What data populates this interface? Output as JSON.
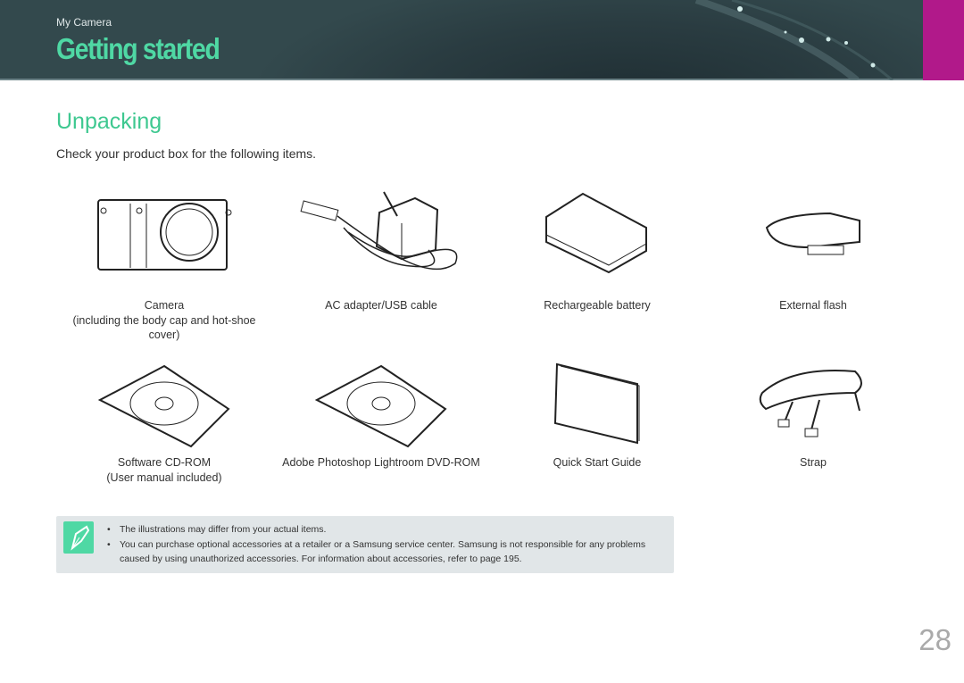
{
  "header": {
    "breadcrumb": "My Camera",
    "title": "Getting started",
    "accent": "#4fd8a4",
    "tab_color": "#b1198a"
  },
  "section": {
    "title": "Unpacking",
    "intro": "Check your product box for the following items."
  },
  "items": [
    {
      "label": "Camera",
      "sub": "(including the body cap and hot-shoe cover)",
      "icon": "camera-icon"
    },
    {
      "label": "AC adapter/USB cable",
      "sub": "",
      "icon": "adapter-cable-icon"
    },
    {
      "label": "Rechargeable battery",
      "sub": "",
      "icon": "battery-icon"
    },
    {
      "label": "External flash",
      "sub": "",
      "icon": "flash-icon"
    },
    {
      "label": "Software CD-ROM",
      "sub": "(User manual included)",
      "icon": "cd-rom-icon"
    },
    {
      "label": "Adobe Photoshop Lightroom DVD-ROM",
      "sub": "",
      "icon": "dvd-rom-icon"
    },
    {
      "label": "Quick Start Guide",
      "sub": "",
      "icon": "guide-booklet-icon"
    },
    {
      "label": "Strap",
      "sub": "",
      "icon": "strap-icon"
    }
  ],
  "note": {
    "icon": "pen-note-icon",
    "bullets": [
      "The illustrations may differ from your actual items.",
      "You can purchase optional accessories at a retailer or a Samsung service center. Samsung is not responsible for any problems caused by using unauthorized accessories. For information about accessories, refer to page 195."
    ]
  },
  "page_number": "28"
}
